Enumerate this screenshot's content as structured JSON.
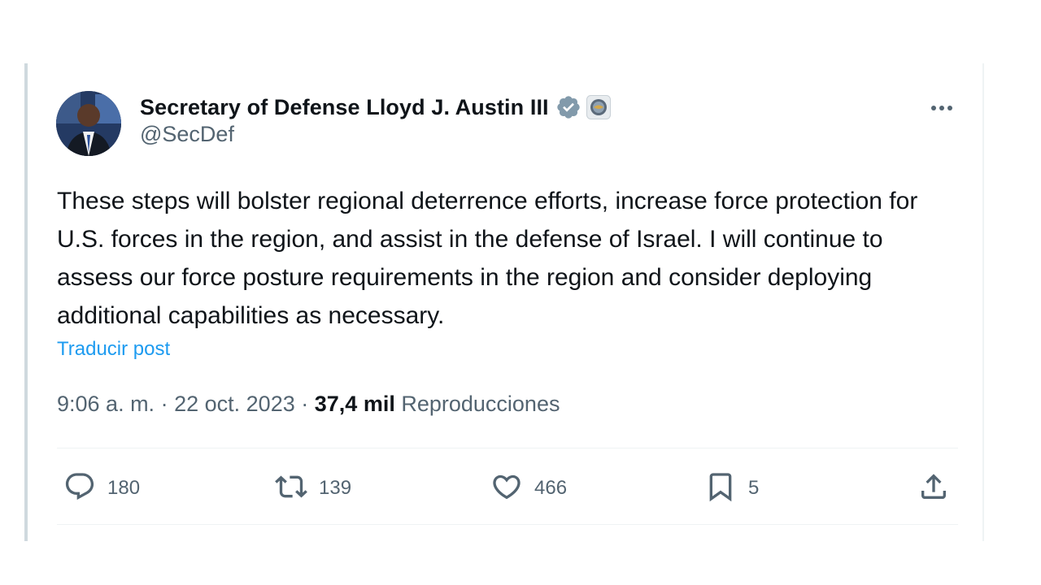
{
  "tweet": {
    "author": {
      "name": "Secretary of Defense Lloyd J. Austin III",
      "handle": "@SecDef"
    },
    "text": "These steps will bolster regional deterrence efforts, increase force protection for U.S. forces in the region, and assist in the defense of Israel. I will continue to assess our force posture requirements in the region and consider deploying additional capabilities as necessary.",
    "translate_label": "Traducir post",
    "time": "9:06 a. m.",
    "separator": "·",
    "date": "22 oct. 2023",
    "views_count": "37,4 mil",
    "views_label": "Reproducciones"
  },
  "actions": {
    "replies": "180",
    "reposts": "139",
    "likes": "466",
    "bookmarks": "5"
  },
  "colors": {
    "text": "#0f1419",
    "secondary": "#536471",
    "link": "#1d9bf0",
    "verified_badge": "#829aab"
  },
  "icons": [
    "verified-badge-icon",
    "gov-affiliation-icon",
    "more-icon",
    "reply-icon",
    "repost-icon",
    "like-icon",
    "bookmark-icon",
    "share-icon"
  ]
}
